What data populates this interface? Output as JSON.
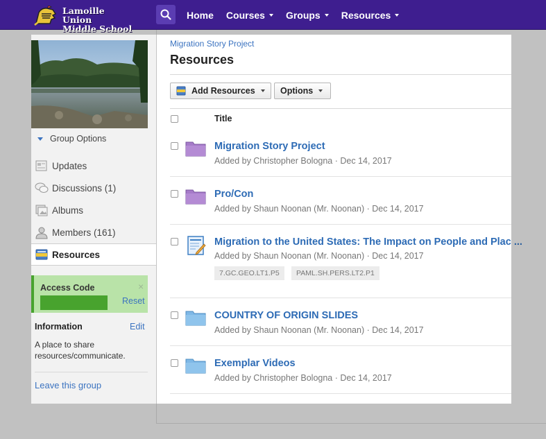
{
  "school": {
    "name_line1": "Lamoille Union",
    "name_line2": "Middle School"
  },
  "nav": {
    "items": [
      {
        "label": "Home",
        "caret": false
      },
      {
        "label": "Courses",
        "caret": true
      },
      {
        "label": "Groups",
        "caret": true
      },
      {
        "label": "Resources",
        "caret": true
      }
    ]
  },
  "sidebar": {
    "group_options": "Group Options",
    "items": [
      {
        "label": "Updates",
        "icon": "updates-icon"
      },
      {
        "label": "Discussions (1)",
        "icon": "discussions-icon"
      },
      {
        "label": "Albums",
        "icon": "albums-icon"
      },
      {
        "label": "Members (161)",
        "icon": "members-icon"
      },
      {
        "label": "Resources",
        "icon": "resources-icon",
        "active": true
      }
    ],
    "access_code": {
      "label": "Access Code",
      "close": "×",
      "reset": "Reset"
    },
    "information": {
      "title": "Information",
      "edit": "Edit",
      "description": "A place to share resources/communicate."
    },
    "leave": "Leave this group"
  },
  "main": {
    "breadcrumb": "Migration Story Project",
    "title": "Resources",
    "add_resources": "Add Resources",
    "options": "Options",
    "column_title": "Title",
    "rows": [
      {
        "title": "Migration Story Project",
        "meta": "Added by Christopher Bologna · Dec 14, 2017",
        "icon": "folder-purple-icon"
      },
      {
        "title": "Pro/Con",
        "meta": "Added by Shaun Noonan (Mr. Noonan) · Dec 14, 2017",
        "icon": "folder-purple-icon"
      },
      {
        "title": "Migration to the United States: The Impact on People and Plac ...",
        "meta": "Added by Shaun Noonan (Mr. Noonan) · Dec 14, 2017",
        "icon": "assignment-icon",
        "tags": [
          "7.GC.GEO.LT1.P5",
          "PAML.SH.PERS.LT2.P1"
        ]
      },
      {
        "title": "COUNTRY OF ORIGIN SLIDES",
        "meta": "Added by Shaun Noonan (Mr. Noonan) · Dec 14, 2017",
        "icon": "folder-blue-icon"
      },
      {
        "title": "Exemplar Videos",
        "meta": "Added by Christopher Bologna · Dec 14, 2017",
        "icon": "folder-blue-icon"
      }
    ]
  },
  "colors": {
    "nav_bg": "#3e1e8f",
    "link": "#2d6bb5",
    "access_bg": "#b9e3a8",
    "access_accent": "#48a32e",
    "folder_purple": "#a67bc9",
    "folder_blue": "#7fb8e6"
  }
}
